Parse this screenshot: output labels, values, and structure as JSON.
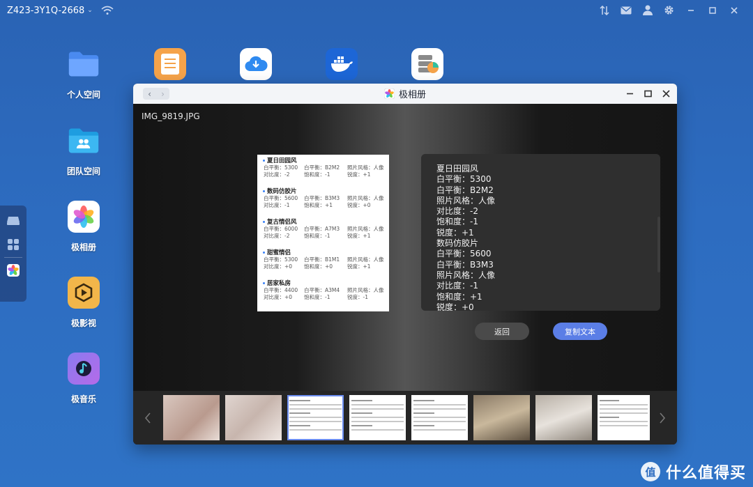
{
  "topbar": {
    "device_name": "Z423-3Y1Q-2668",
    "caret": "⌄"
  },
  "desktop": {
    "icons": [
      {
        "label": "个人空间"
      },
      {
        "label": "团队空间"
      },
      {
        "label": "极相册"
      },
      {
        "label": "极影视"
      },
      {
        "label": "极音乐"
      }
    ]
  },
  "window": {
    "title": "极相册",
    "nav_back": "‹",
    "nav_forward": "›",
    "filename": "IMG_9819.JPG",
    "doc_sections": [
      {
        "title": "夏日田园风",
        "rows": [
          [
            "白平衡：5300",
            "白平衡：B2M2",
            "照片风格：人像"
          ],
          [
            "对比度：-2",
            "饱和度：-1",
            "锐度：+1"
          ]
        ]
      },
      {
        "title": "数码仿胶片",
        "rows": [
          [
            "白平衡：5600",
            "白平衡：B3M3",
            "照片风格：人像"
          ],
          [
            "对比度：-1",
            "饱和度：+1",
            "锐度：+0"
          ]
        ]
      },
      {
        "title": "复古情侣风",
        "rows": [
          [
            "白平衡：6000",
            "白平衡：A7M3",
            "照片风格：人像"
          ],
          [
            "对比度：-2",
            "饱和度：-1",
            "锐度：+1"
          ]
        ]
      },
      {
        "title": "甜蜜情侣",
        "rows": [
          [
            "白平衡：5300",
            "白平衡：B1M1",
            "照片风格：人像"
          ],
          [
            "对比度：+0",
            "饱和度：+0",
            "锐度：+1"
          ]
        ]
      },
      {
        "title": "居家私房",
        "rows": [
          [
            "白平衡：4400",
            "白平衡：A3M4",
            "照片风格：人像"
          ],
          [
            "对比度：+0",
            "饱和度：-1",
            "锐度：-1"
          ]
        ]
      }
    ],
    "ocr_lines": [
      "夏日田园风",
      "白平衡：5300",
      "白平衡：B2M2",
      "照片风格：人像",
      "对比度：-2",
      "饱和度：-1",
      "锐度：+1",
      "数码仿胶片",
      "白平衡：5600",
      "白平衡：B3M3",
      "照片风格：人像",
      "对比度：-1",
      "饱和度：+1",
      "锐度：+0"
    ],
    "btn_back": "返回",
    "btn_copy": "复制文本"
  },
  "watermark": {
    "text": "什么值得买"
  },
  "colors": {
    "accent": "#5b7ee6",
    "desktop_bg": "#2d6cc0"
  }
}
